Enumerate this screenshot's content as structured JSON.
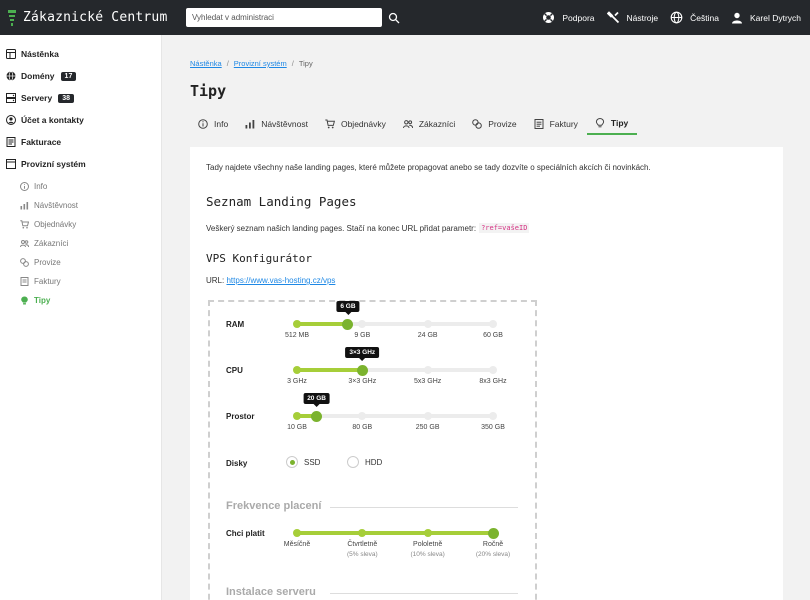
{
  "header": {
    "brand": "Zákaznické Centrum",
    "search_placeholder": "Vyhledat v administraci",
    "nav": [
      {
        "label": "Podpora",
        "icon": "lifebuoy-icon"
      },
      {
        "label": "Nástroje",
        "icon": "tools-icon"
      },
      {
        "label": "Čeština",
        "icon": "globe-icon"
      },
      {
        "label": "Karel Dytrych",
        "icon": "user-icon"
      }
    ]
  },
  "sidebar": {
    "items": [
      {
        "label": "Nástěnka",
        "icon": "dashboard-icon",
        "badge": ""
      },
      {
        "label": "Domény",
        "icon": "globe-icon",
        "badge": "17"
      },
      {
        "label": "Servery",
        "icon": "server-icon",
        "badge": "38"
      },
      {
        "label": "Účet a kontakty",
        "icon": "account-icon",
        "badge": ""
      },
      {
        "label": "Fakturace",
        "icon": "invoice-icon",
        "badge": ""
      },
      {
        "label": "Provizní systém",
        "icon": "window-icon",
        "badge": ""
      }
    ],
    "subitems": [
      {
        "label": "Info",
        "icon": "info-icon"
      },
      {
        "label": "Návštěvnost",
        "icon": "chart-icon"
      },
      {
        "label": "Objednávky",
        "icon": "cart-icon"
      },
      {
        "label": "Zákazníci",
        "icon": "users-icon"
      },
      {
        "label": "Provize",
        "icon": "coins-icon"
      },
      {
        "label": "Faktury",
        "icon": "document-icon"
      },
      {
        "label": "Tipy",
        "icon": "lightbulb-icon"
      }
    ]
  },
  "breadcrumb": {
    "home": "Nástěnka",
    "section": "Provizní systém",
    "current": "Tipy"
  },
  "page_title": "Tipy",
  "tabs": [
    {
      "label": "Info",
      "icon": "info-icon"
    },
    {
      "label": "Návštěvnost",
      "icon": "chart-icon"
    },
    {
      "label": "Objednávky",
      "icon": "cart-icon"
    },
    {
      "label": "Zákazníci",
      "icon": "users-icon"
    },
    {
      "label": "Provize",
      "icon": "coins-icon"
    },
    {
      "label": "Faktury",
      "icon": "document-icon"
    },
    {
      "label": "Tipy",
      "icon": "lightbulb-icon"
    }
  ],
  "content": {
    "intro": "Tady najdete všechny naše landing pages, které můžete propagovat anebo se tady dozvíte o speciálních akcích či novinkách.",
    "landing_title": "Seznam Landing Pages",
    "landing_desc": "Veškerý seznam našich landing pages. Stačí na konec URL přidat parametr:",
    "param_code": "?ref=vašeID",
    "vps_title": "VPS Konfigurátor",
    "url_label": "URL:",
    "url_link": "https://www.vas-hosting.cz/vps"
  },
  "configurator": {
    "ram": {
      "label": "RAM",
      "tooltip": "6 GB",
      "ticks": [
        "512 MB",
        "9 GB",
        "24 GB",
        "60 GB"
      ],
      "position": 0.26
    },
    "cpu": {
      "label": "CPU",
      "tooltip": "3×3 GHz",
      "ticks": [
        "3 GHz",
        "3×3 GHz",
        "5x3 GHz",
        "8x3 GHz"
      ],
      "position": 0.333
    },
    "storage": {
      "label": "Prostor",
      "tooltip": "20 GB",
      "ticks": [
        "10 GB",
        "80 GB",
        "250 GB",
        "350 GB"
      ],
      "position": 0.1
    },
    "disks": {
      "label": "Disky",
      "options": [
        "SSD",
        "HDD"
      ],
      "selected": "SSD"
    },
    "billing_title": "Frekvence placení",
    "billing": {
      "label": "Chci platit",
      "ticks": [
        {
          "label": "Měsíčně",
          "sub": ""
        },
        {
          "label": "Čtvrtletně",
          "sub": "(5% sleva)"
        },
        {
          "label": "Pololetně",
          "sub": "(10% sleva)"
        },
        {
          "label": "Ročně",
          "sub": "(20% sleva)"
        }
      ],
      "position": 1.0
    },
    "install_title": "Instalace serveru"
  },
  "colors": {
    "accent": "#4caf50",
    "slider_fill": "#a6ce39",
    "slider_handle": "#7bb32e",
    "topbar": "#25282c",
    "link": "#1e88e5"
  }
}
